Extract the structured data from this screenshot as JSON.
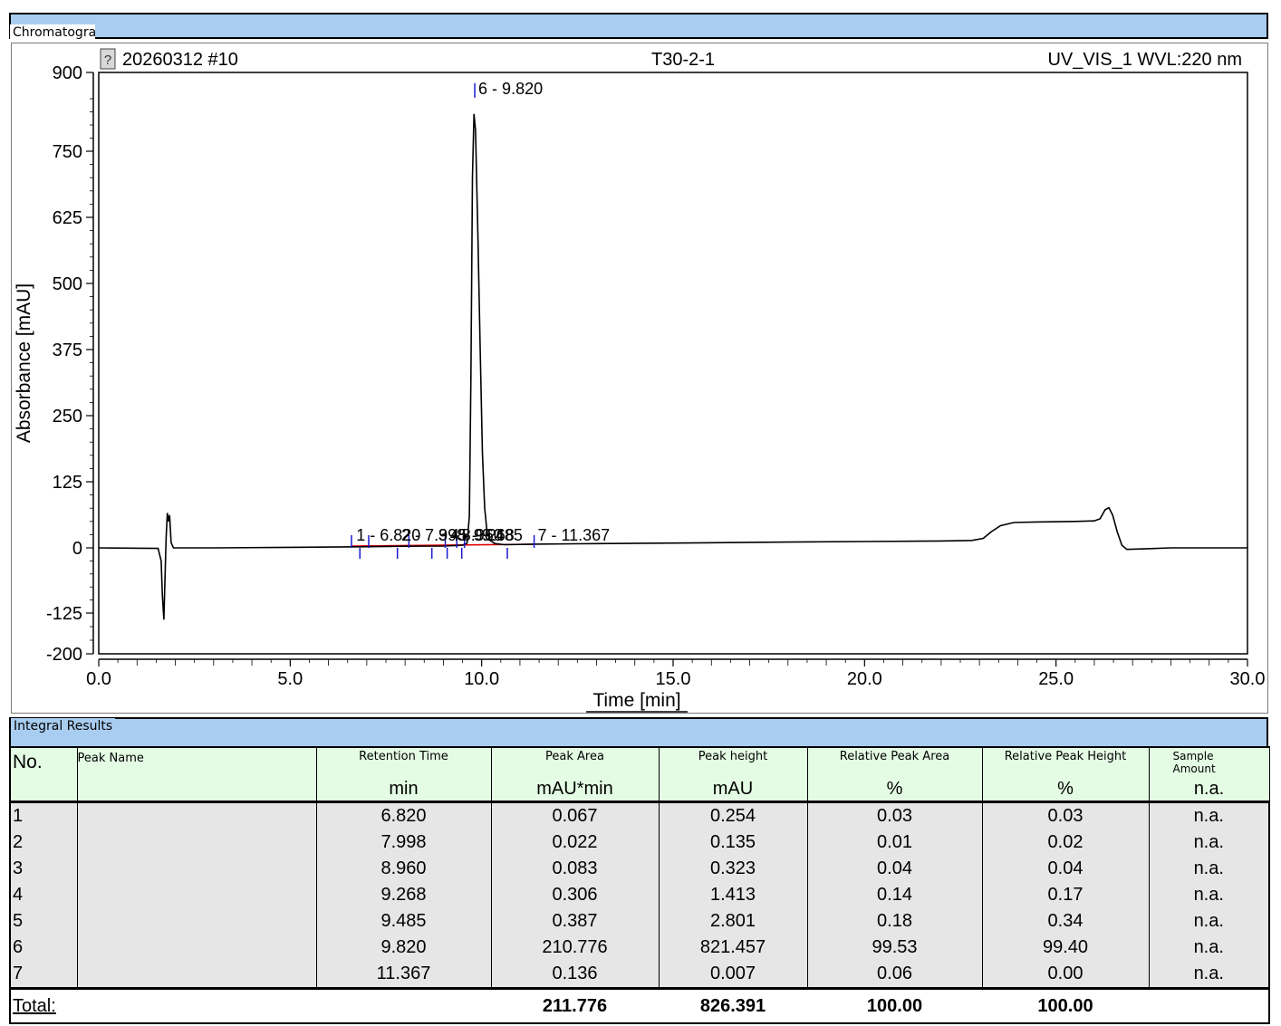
{
  "chart_panel": {
    "tab_label": "Chromatogram"
  },
  "results_panel": {
    "tab_label": "Integral Results"
  },
  "chart_data": {
    "type": "line",
    "header": {
      "injection": "20260312 #10",
      "sample": "T30-2-1",
      "channel": "UV_VIS_1 WVL:220 nm"
    },
    "xlabel": "Time [min]",
    "ylabel": "Absorbance [mAU]",
    "xlim": [
      0.0,
      30.0
    ],
    "ylim": [
      -200,
      900
    ],
    "x_ticks": [
      "0.0",
      "5.0",
      "10.0",
      "15.0",
      "20.0",
      "25.0",
      "30.0"
    ],
    "y_ticks": [
      "-200",
      "-125",
      "0",
      "125",
      "250",
      "375",
      "500",
      "625",
      "750",
      "900"
    ],
    "series": [
      {
        "color": "#000000",
        "points": [
          [
            0.0,
            0
          ],
          [
            1.55,
            -1
          ],
          [
            1.63,
            -25
          ],
          [
            1.66,
            -90
          ],
          [
            1.7,
            -137
          ],
          [
            1.73,
            -60
          ],
          [
            1.76,
            20
          ],
          [
            1.79,
            66
          ],
          [
            1.82,
            50
          ],
          [
            1.85,
            62
          ],
          [
            1.89,
            10
          ],
          [
            1.95,
            0
          ],
          [
            3.0,
            0
          ],
          [
            5.0,
            1
          ],
          [
            6.82,
            2
          ],
          [
            8.0,
            3
          ],
          [
            9.0,
            3.5
          ],
          [
            9.5,
            5
          ],
          [
            9.62,
            9
          ],
          [
            9.68,
            60
          ],
          [
            9.72,
            320
          ],
          [
            9.76,
            700
          ],
          [
            9.8,
            821
          ],
          [
            9.84,
            790
          ],
          [
            9.9,
            600
          ],
          [
            9.96,
            380
          ],
          [
            10.02,
            180
          ],
          [
            10.08,
            75
          ],
          [
            10.14,
            30
          ],
          [
            10.22,
            14
          ],
          [
            10.35,
            8
          ],
          [
            10.6,
            6
          ],
          [
            11.37,
            7
          ],
          [
            13.0,
            8
          ],
          [
            15.0,
            9
          ],
          [
            18.0,
            11
          ],
          [
            20.0,
            12
          ],
          [
            22.0,
            13
          ],
          [
            22.8,
            14
          ],
          [
            23.1,
            18
          ],
          [
            23.3,
            30
          ],
          [
            23.55,
            42
          ],
          [
            23.9,
            48
          ],
          [
            24.5,
            49
          ],
          [
            25.5,
            50
          ],
          [
            26.0,
            51
          ],
          [
            26.15,
            55
          ],
          [
            26.28,
            72
          ],
          [
            26.38,
            76
          ],
          [
            26.48,
            62
          ],
          [
            26.6,
            30
          ],
          [
            26.72,
            5
          ],
          [
            26.85,
            -3
          ],
          [
            27.2,
            -2
          ],
          [
            28.0,
            0
          ],
          [
            29.0,
            0
          ],
          [
            30.0,
            0
          ]
        ]
      }
    ],
    "peak_labels": [
      {
        "text": "1 - 6.820",
        "x": 6.82
      },
      {
        "text": "2 - 7.998",
        "x": 7.998
      },
      {
        "text": "3 - 8.960",
        "x": 8.96
      },
      {
        "text": "4 - 9.268",
        "x": 9.268
      },
      {
        "text": "5 - 9.485",
        "x": 9.485
      },
      {
        "text": "6 - 9.820",
        "x": 9.82
      },
      {
        "text": "7 - 11.367",
        "x": 11.367
      }
    ],
    "integration_marks": [
      6.6,
      6.82,
      7.05,
      7.8,
      8.1,
      8.7,
      9.05,
      9.1,
      9.35,
      9.48,
      9.55,
      10.67,
      11.37
    ],
    "baseline_color": "#e00000",
    "mark_color": "#1a1ad0"
  },
  "integral_results": {
    "columns": [
      {
        "name": "No.",
        "unit": ""
      },
      {
        "name": "Peak Name",
        "unit": ""
      },
      {
        "name": "Retention Time",
        "unit": "min"
      },
      {
        "name": "Peak Area",
        "unit": "mAU*min"
      },
      {
        "name": "Peak height",
        "unit": "mAU"
      },
      {
        "name": "Relative Peak Area",
        "unit": "%"
      },
      {
        "name": "Relative Peak Height",
        "unit": "%"
      },
      {
        "name": "Sample Amount",
        "unit": "n.a."
      }
    ],
    "rows": [
      [
        "1",
        "",
        "6.820",
        "0.067",
        "0.254",
        "0.03",
        "0.03",
        "n.a."
      ],
      [
        "2",
        "",
        "7.998",
        "0.022",
        "0.135",
        "0.01",
        "0.02",
        "n.a."
      ],
      [
        "3",
        "",
        "8.960",
        "0.083",
        "0.323",
        "0.04",
        "0.04",
        "n.a."
      ],
      [
        "4",
        "",
        "9.268",
        "0.306",
        "1.413",
        "0.14",
        "0.17",
        "n.a."
      ],
      [
        "5",
        "",
        "9.485",
        "0.387",
        "2.801",
        "0.18",
        "0.34",
        "n.a."
      ],
      [
        "6",
        "",
        "9.820",
        "210.776",
        "821.457",
        "99.53",
        "99.40",
        "n.a."
      ],
      [
        "7",
        "",
        "11.367",
        "0.136",
        "0.007",
        "0.06",
        "0.00",
        "n.a."
      ]
    ],
    "total": {
      "label": "Total:",
      "area": "211.776",
      "height": "826.391",
      "rel_area": "100.00",
      "rel_height": "100.00"
    }
  }
}
